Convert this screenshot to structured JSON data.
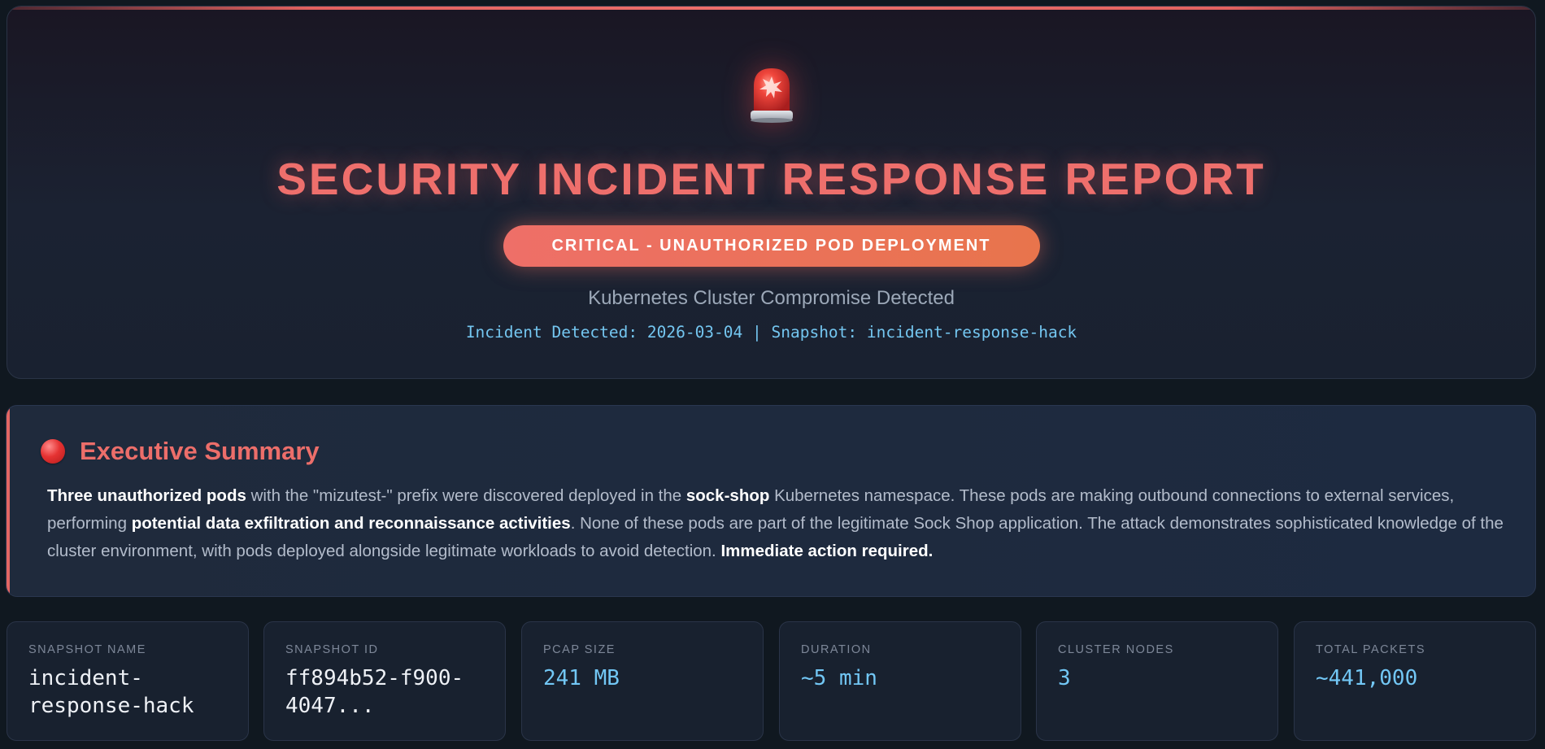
{
  "hero": {
    "icon": "siren-icon",
    "title": "SECURITY INCIDENT RESPONSE REPORT",
    "badge": "CRITICAL - UNAUTHORIZED POD DEPLOYMENT",
    "subtitle": "Kubernetes Cluster Compromise Detected",
    "meta": "Incident Detected: 2026-03-04 | Snapshot: incident-response-hack"
  },
  "summary": {
    "icon": "red-circle-icon",
    "title": "Executive Summary",
    "p1_bold": "Three unauthorized pods",
    "p2": " with the \"mizutest-\" prefix were discovered deployed in the ",
    "p3_bold": "sock-shop",
    "p4": " Kubernetes namespace. These pods are making outbound connections to external services, performing ",
    "p5_bold": "potential data exfiltration and reconnaissance activities",
    "p6": ". None of these pods are part of the legitimate Sock Shop application. The attack demonstrates sophisticated knowledge of the cluster environment, with pods deployed alongside legitimate workloads to avoid detection. ",
    "p7_bold": "Immediate action required."
  },
  "stats": [
    {
      "label": "SNAPSHOT NAME",
      "value": "incident-response-hack"
    },
    {
      "label": "SNAPSHOT ID",
      "value": "ff894b52-f900-4047..."
    },
    {
      "label": "PCAP SIZE",
      "value": "241 MB"
    },
    {
      "label": "DURATION",
      "value": "~5 min"
    },
    {
      "label": "CLUSTER NODES",
      "value": "3"
    },
    {
      "label": "TOTAL PACKETS",
      "value": "~441,000"
    }
  ],
  "colors": {
    "accent_red": "#ec6e6a",
    "badge_start": "#ee6f68",
    "badge_end": "#e8744c",
    "meta_blue": "#74c6f0",
    "background": "#101820"
  }
}
